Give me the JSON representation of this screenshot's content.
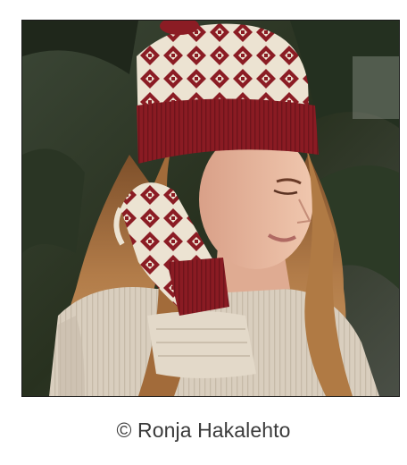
{
  "figure": {
    "photo": {
      "alt": "Woman with long wavy hair wearing a red and cream patterned knit hat and mittens, holding her hand to her neck",
      "colors": {
        "hat_red": "#8b1c24",
        "cream": "#ece3d2",
        "sweater": "#d8cdbd",
        "hair": "#a9703f",
        "skin": "#e7b9a0",
        "background": "#2f3a2b"
      }
    },
    "caption": "© Ronja Hakalehto"
  }
}
